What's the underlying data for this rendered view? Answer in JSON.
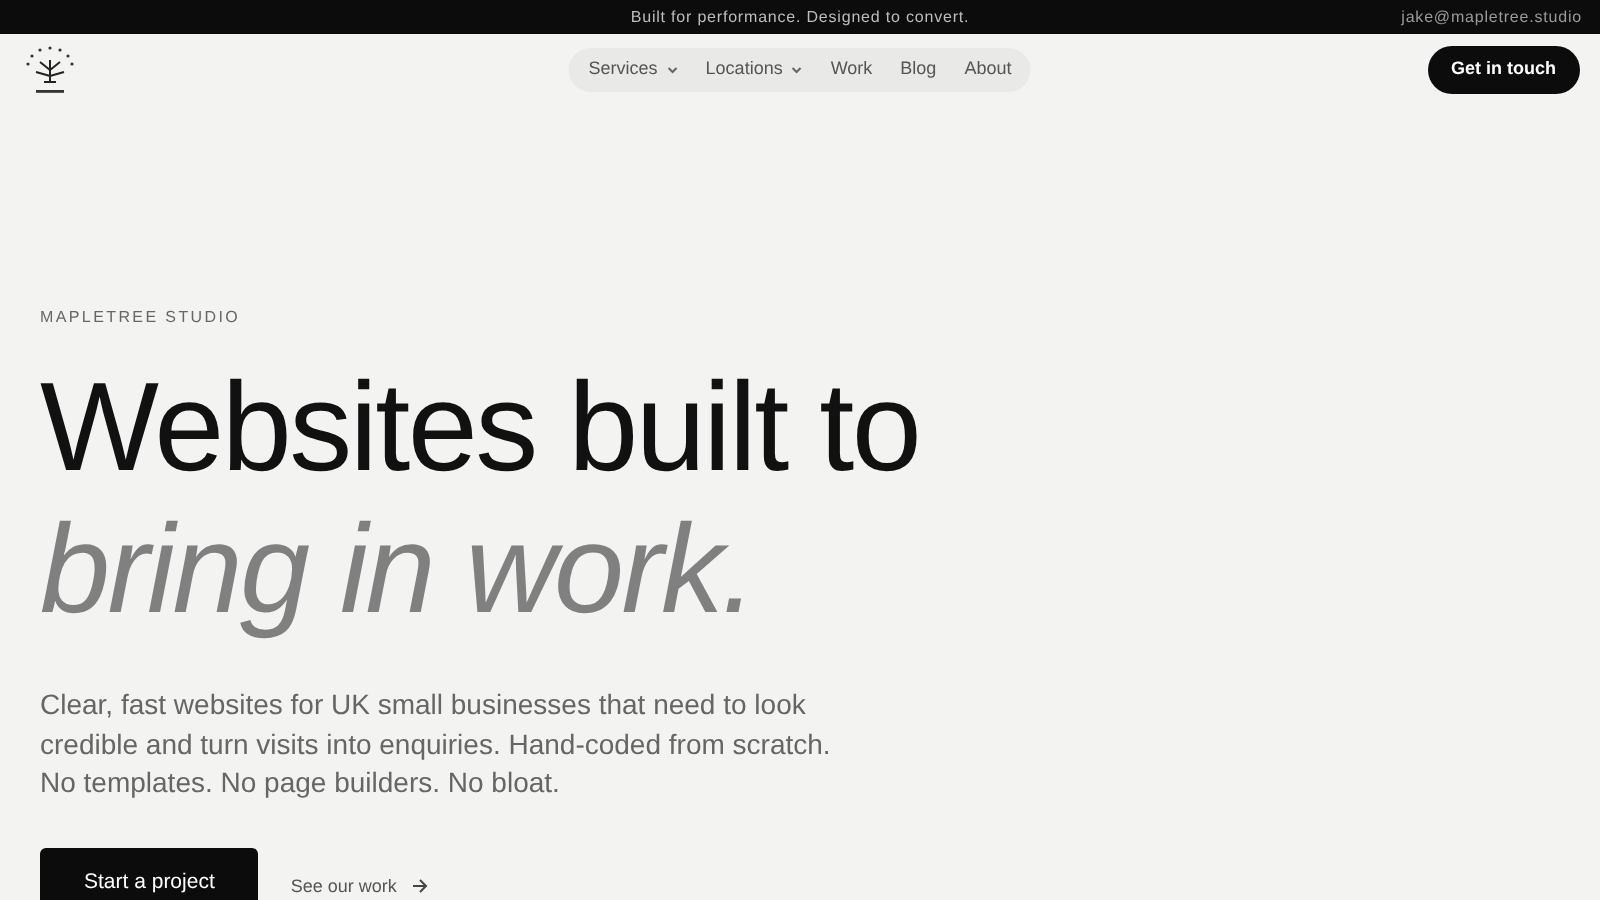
{
  "top_bar": {
    "tagline": "Built for performance. Designed to convert.",
    "email": "jake@mapletree.studio"
  },
  "nav": {
    "items": [
      {
        "label": "Services",
        "dropdown": true
      },
      {
        "label": "Locations",
        "dropdown": true
      },
      {
        "label": "Work",
        "dropdown": false
      },
      {
        "label": "Blog",
        "dropdown": false
      },
      {
        "label": "About",
        "dropdown": false
      }
    ],
    "cta": "Get in touch"
  },
  "hero": {
    "eyebrow": "MAPLETREE STUDIO",
    "title_line_1": "Websites built to",
    "title_line_2": "bring in work.",
    "text": "Clear, fast websites for UK small businesses that need to look credible and turn visits into enquiries. Hand-coded from scratch. No templates. No page builders. No bloat.",
    "primary_button": "Start a project",
    "secondary_link": "See our work"
  }
}
